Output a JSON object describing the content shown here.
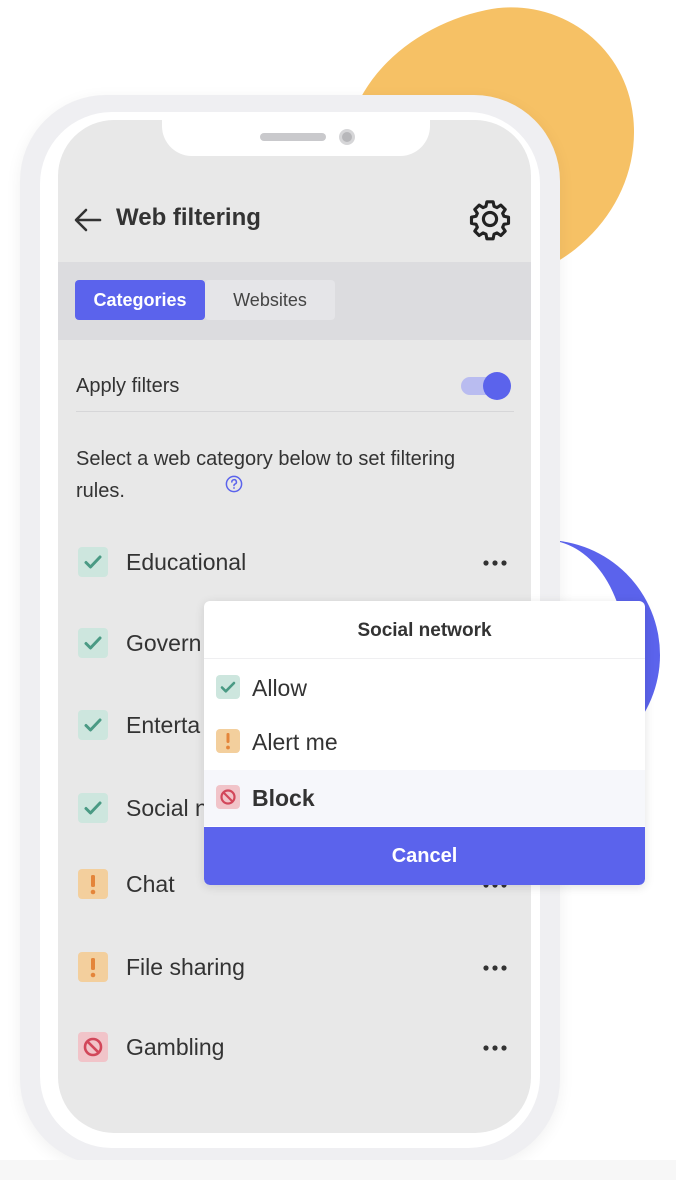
{
  "colors": {
    "accent": "#5b63ec",
    "allow": "#4a9a84",
    "alert": "#e4853a",
    "block": "#d2475a",
    "blob": "#f6c165"
  },
  "header": {
    "back_icon": "arrow-left-icon",
    "title": "Web filtering",
    "settings_icon": "gear-icon"
  },
  "tabs": [
    {
      "label": "Categories",
      "active": true
    },
    {
      "label": "Websites",
      "active": false
    }
  ],
  "apply_filters": {
    "label": "Apply filters",
    "enabled": true
  },
  "description": "Select a web category below to set filtering rules.",
  "categories": [
    {
      "label": "Educational",
      "status": "allow"
    },
    {
      "label": "Govern",
      "status": "allow"
    },
    {
      "label": "Enterta",
      "status": "allow"
    },
    {
      "label": "Social n",
      "status": "allow"
    },
    {
      "label": "Chat",
      "status": "alert"
    },
    {
      "label": "File sharing",
      "status": "alert"
    },
    {
      "label": "Gambling",
      "status": "block"
    }
  ],
  "popup": {
    "title": "Social network",
    "options": [
      {
        "label": "Allow",
        "status": "allow",
        "selected": false
      },
      {
        "label": "Alert me",
        "status": "alert",
        "selected": false
      },
      {
        "label": "Block",
        "status": "block",
        "selected": true
      }
    ],
    "cancel_label": "Cancel"
  }
}
